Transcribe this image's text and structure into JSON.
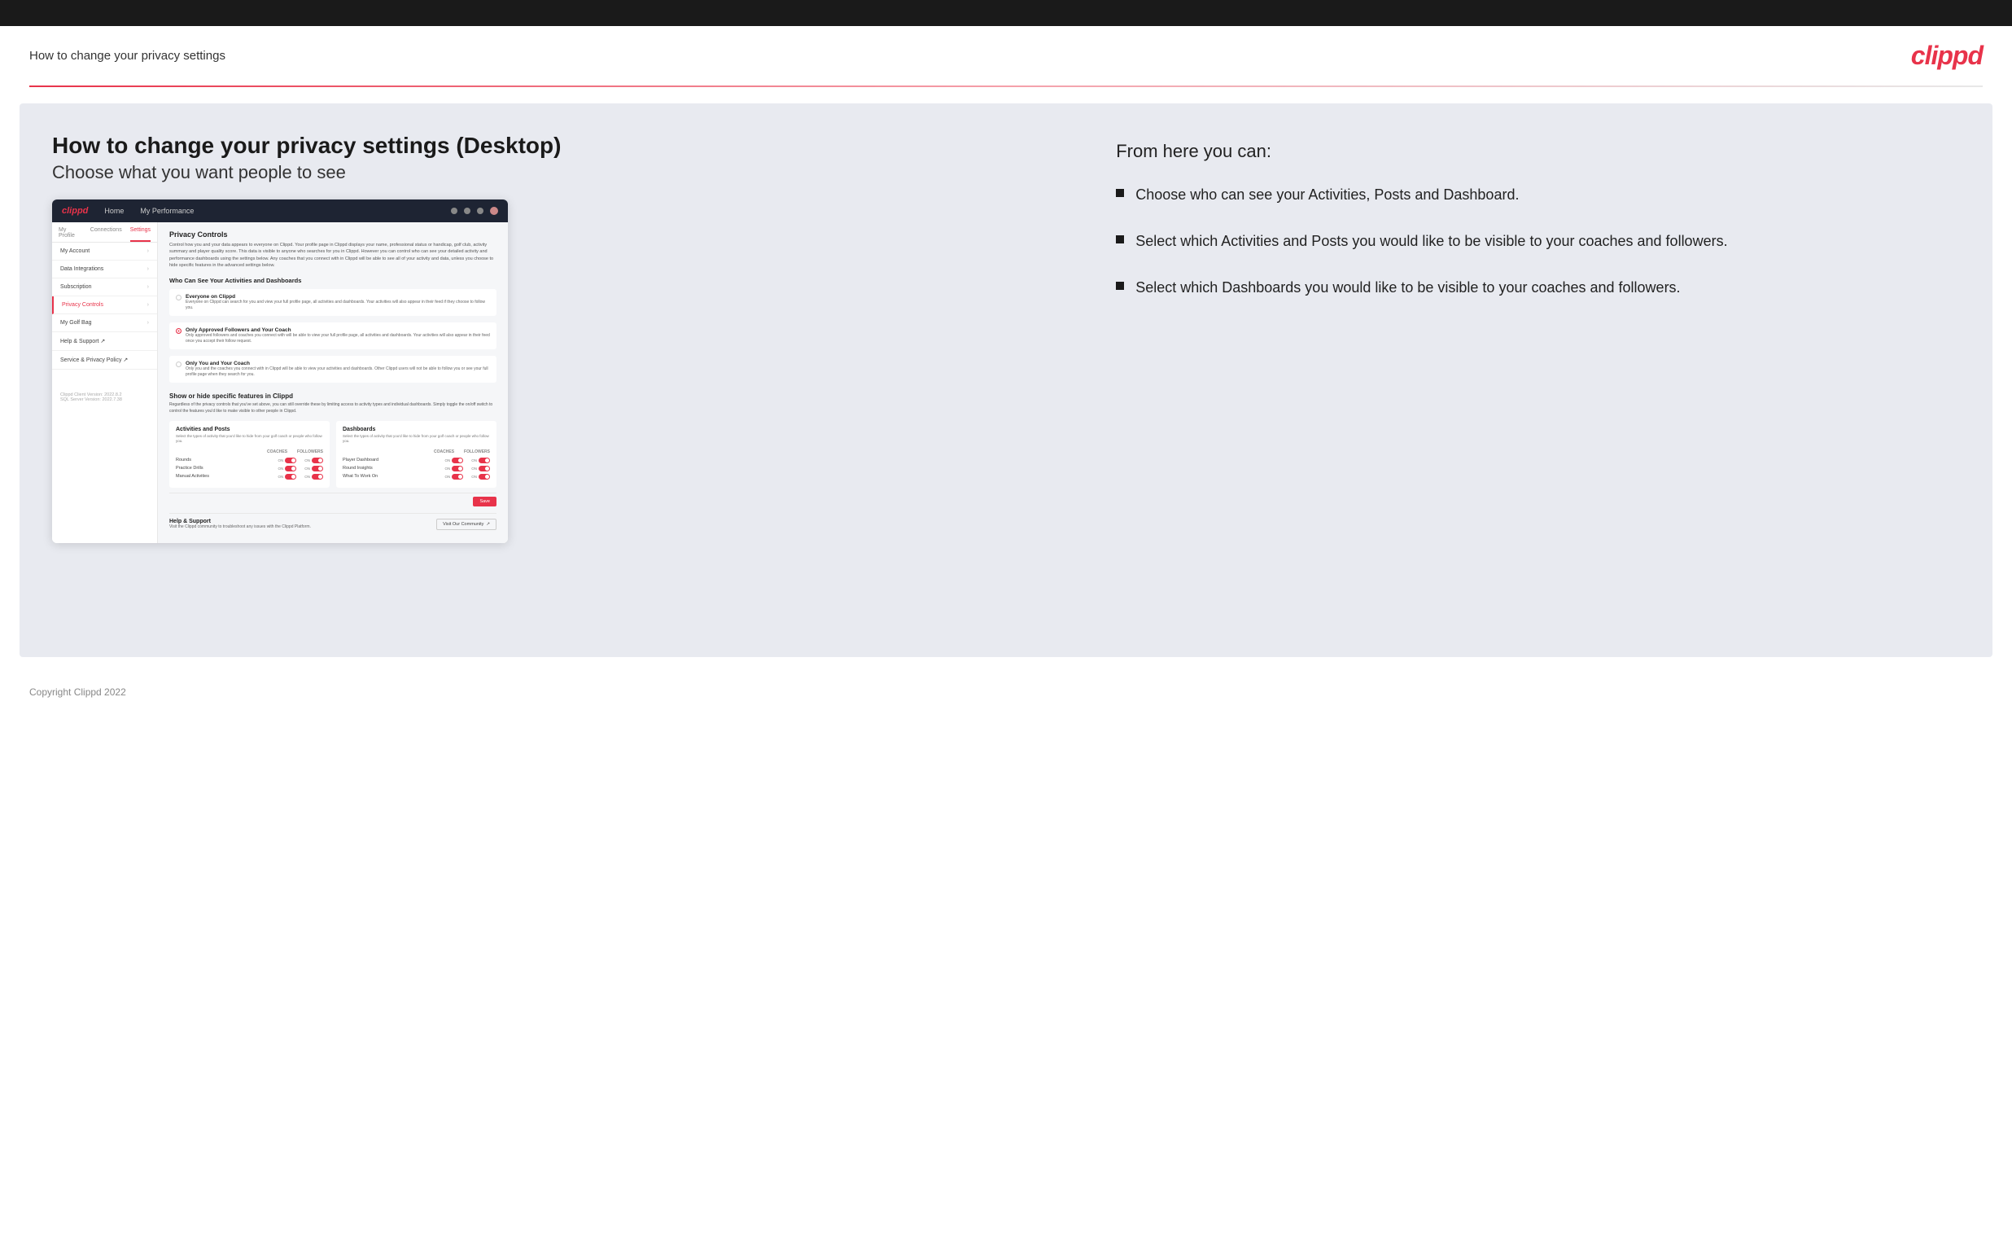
{
  "topBar": {},
  "header": {
    "title": "How to change your privacy settings",
    "logo": "clippd"
  },
  "main": {
    "heading": "How to change your privacy settings (Desktop)",
    "subheading": "Choose what you want people to see",
    "screenshot": {
      "nav": {
        "logo": "clippd",
        "items": [
          "Home",
          "My Performance"
        ]
      },
      "sidebar": {
        "tabs": [
          "My Profile",
          "Connections",
          "Settings"
        ],
        "activeTab": "Settings",
        "items": [
          {
            "label": "My Account",
            "active": false
          },
          {
            "label": "Data Integrations",
            "active": false
          },
          {
            "label": "Subscription",
            "active": false
          },
          {
            "label": "Privacy Controls",
            "active": true
          },
          {
            "label": "My Golf Bag",
            "active": false
          },
          {
            "label": "Help & Support",
            "active": false
          },
          {
            "label": "Service & Privacy Policy",
            "active": false
          }
        ],
        "footer": {
          "line1": "Clippd Client Version: 2022.8.2",
          "line2": "SQL Server Version: 2022.7.38"
        }
      },
      "main": {
        "sectionTitle": "Privacy Controls",
        "sectionDesc": "Control how you and your data appears to everyone on Clippd. Your profile page in Clippd displays your name, professional status or handicap, golf club, activity summary and player quality score. This data is visible to anyone who searches for you in Clippd. However you can control who can see your detailed activity and performance dashboards using the settings below. Any coaches that you connect with in Clippd will be able to see all of your activity and data, unless you choose to hide specific features in the advanced settings below.",
        "whoCanSeeTitle": "Who Can See Your Activities and Dashboards",
        "radioOptions": [
          {
            "label": "Everyone on Clippd",
            "desc": "Everyone on Clippd can search for you and view your full profile page, all activities and dashboards. Your activities will also appear in their feed if they choose to follow you.",
            "selected": false
          },
          {
            "label": "Only Approved Followers and Your Coach",
            "desc": "Only approved followers and coaches you connect with will be able to view your full profile page, all activities and dashboards. Your activities will also appear in their feed once you accept their follow request.",
            "selected": true
          },
          {
            "label": "Only You and Your Coach",
            "desc": "Only you and the coaches you connect with in Clippd will be able to view your activities and dashboards. Other Clippd users will not be able to follow you or see your full profile page when they search for you.",
            "selected": false
          }
        ],
        "showHideTitle": "Show or hide specific features in Clippd",
        "showHideDesc": "Regardless of the privacy controls that you've set above, you can still override these by limiting access to activity types and individual dashboards. Simply toggle the on/off switch to control the features you'd like to make visible to other people in Clippd.",
        "activitiesCard": {
          "title": "Activities and Posts",
          "desc": "Select the types of activity that you'd like to hide from your golf coach or people who follow you.",
          "columns": [
            "COACHES",
            "FOLLOWERS"
          ],
          "rows": [
            {
              "label": "Rounds"
            },
            {
              "label": "Practice Drills"
            },
            {
              "label": "Manual Activities"
            }
          ]
        },
        "dashboardsCard": {
          "title": "Dashboards",
          "desc": "Select the types of activity that you'd like to hide from your golf coach or people who follow you.",
          "columns": [
            "COACHES",
            "FOLLOWERS"
          ],
          "rows": [
            {
              "label": "Player Dashboard"
            },
            {
              "label": "Round Insights"
            },
            {
              "label": "What To Work On"
            }
          ]
        },
        "saveLabel": "Save",
        "helpSection": {
          "title": "Help & Support",
          "desc": "Visit the Clippd community to troubleshoot any issues with the Clippd Platform.",
          "btnLabel": "Visit Our Community"
        }
      }
    },
    "rightPanel": {
      "fromHereTitle": "From here you can:",
      "bullets": [
        "Choose who can see your Activities, Posts and Dashboard.",
        "Select which Activities and Posts you would like to be visible to your coaches and followers.",
        "Select which Dashboards you would like to be visible to your coaches and followers."
      ]
    }
  },
  "footer": {
    "text": "Copyright Clippd 2022"
  }
}
